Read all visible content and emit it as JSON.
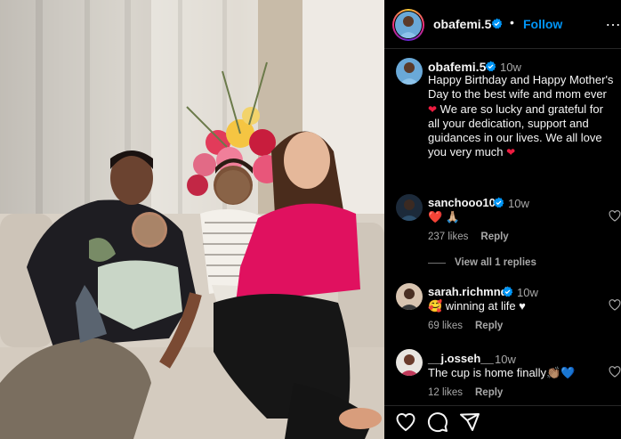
{
  "post": {
    "author": "obafemi.5",
    "follow_label": "Follow",
    "dot": "•",
    "more": "…"
  },
  "caption": {
    "author": "obafemi.5",
    "time": "10w",
    "text": "Happy Birthday and Happy Mother's Day to the best wife and mom ever",
    "text2": " We are so lucky and grateful for all your dedication, support and guidances in our lives. We all love you very much "
  },
  "comments": [
    {
      "user": "sanchooo10",
      "verified": true,
      "time": "10w",
      "text": "❤️ 🙏🏼",
      "likes": "237 likes",
      "reply": "Reply",
      "view_replies": "View all 1 replies"
    },
    {
      "user": "sarah.richmnd",
      "verified": true,
      "time": "10w",
      "text": "🥰 winning at life ♥",
      "likes": "69 likes",
      "reply": "Reply"
    },
    {
      "user": "__j.osseh__",
      "verified": false,
      "time": "10w",
      "text": "The cup is home finally👏🏽💙",
      "likes": "12 likes",
      "reply": "Reply"
    }
  ],
  "colors": {
    "accent": "#0095f6",
    "heart": "#ed1c40",
    "verified": "#0095f6"
  },
  "icons": [
    "verified-badge-icon",
    "heart-icon",
    "comment-icon",
    "share-icon",
    "more-options-icon"
  ]
}
